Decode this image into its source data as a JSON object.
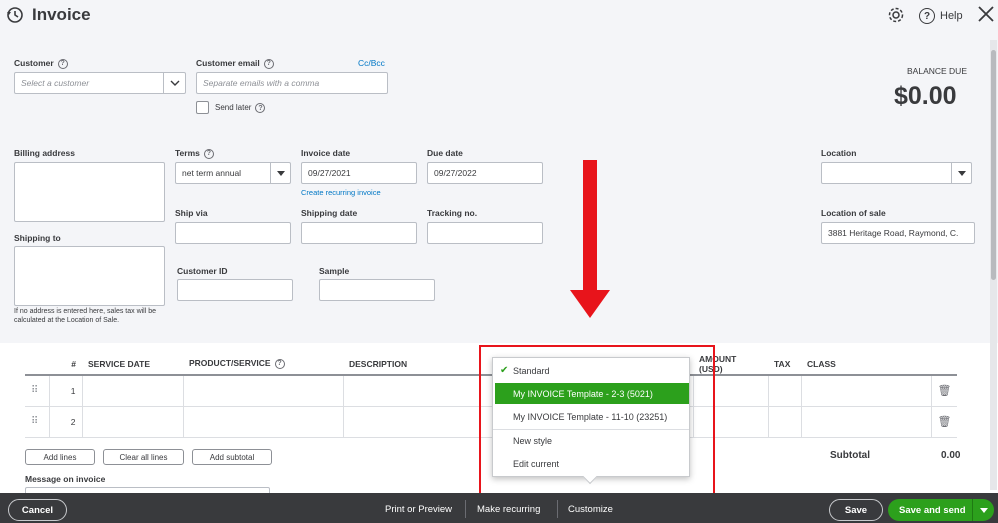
{
  "header": {
    "title": "Invoice",
    "help_label": "Help"
  },
  "customer": {
    "label": "Customer",
    "placeholder": "Select a customer"
  },
  "customer_email": {
    "label": "Customer email",
    "placeholder": "Separate emails with a comma",
    "cc_bcc": "Cc/Bcc",
    "send_later": "Send later"
  },
  "balance": {
    "label": "BALANCE DUE",
    "value": "$0.00"
  },
  "billing_address": {
    "label": "Billing address"
  },
  "shipping_to": {
    "label": "Shipping to",
    "note": "If no address is entered here, sales tax will be calculated at the Location of Sale."
  },
  "terms": {
    "label": "Terms",
    "value": "net term annual"
  },
  "invoice_date": {
    "label": "Invoice date",
    "value": "09/27/2021",
    "recurring_link": "Create recurring invoice"
  },
  "due_date": {
    "label": "Due date",
    "value": "09/27/2022"
  },
  "location": {
    "label": "Location",
    "value": ""
  },
  "ship_via": {
    "label": "Ship via"
  },
  "shipping_date": {
    "label": "Shipping date"
  },
  "tracking": {
    "label": "Tracking no."
  },
  "location_of_sale": {
    "label": "Location of sale",
    "value": "3881  Heritage Road, Raymond, C."
  },
  "customer_id": {
    "label": "Customer ID"
  },
  "sample": {
    "label": "Sample"
  },
  "table": {
    "headers": {
      "num": "#",
      "service_date": "SERVICE DATE",
      "product": "PRODUCT/SERVICE",
      "description": "DESCRIPTION",
      "amount": "AMOUNT (USD)",
      "tax": "TAX",
      "class": "CLASS"
    },
    "rows": [
      {
        "num": "1"
      },
      {
        "num": "2"
      }
    ]
  },
  "line_buttons": {
    "add_lines": "Add lines",
    "clear_all": "Clear all lines",
    "add_subtotal": "Add subtotal"
  },
  "subtotal": {
    "label": "Subtotal",
    "value": "0.00"
  },
  "message": {
    "label": "Message on invoice"
  },
  "dropdown": {
    "items": [
      "Standard",
      "My INVOICE Template - 2-3 (5021)",
      "My INVOICE Template - 11-10 (23251)",
      "New style",
      "Edit current"
    ]
  },
  "footer": {
    "cancel": "Cancel",
    "print_preview": "Print or Preview",
    "make_recurring": "Make recurring",
    "customize": "Customize",
    "save": "Save",
    "save_send": "Save and send"
  },
  "colors": {
    "primary_green": "#2ca01c",
    "footer_bg": "#393a3d",
    "annotation_red": "#e8141b",
    "link_blue": "#0077c5"
  }
}
